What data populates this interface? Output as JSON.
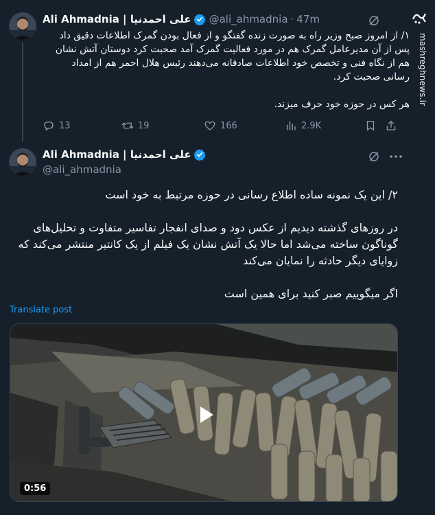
{
  "watermark": {
    "text": "mashreghnews.ir"
  },
  "tweet1": {
    "author_name": "Ali Ahmadnia | علی احمدنیا",
    "handle": "@ali_ahmadnia",
    "time": "47m",
    "lines": [
      "۱/ از امروز صبح وزیر راه به صورت زنده گفتگو و از فعال بودن گمرک اطلاعات دقیق داد",
      "پس از آن مدیرعامل گمرک هم در مورد فعالیت گمرک آمد صحبت کرد دوستان آتش نشان",
      "هم از نگاه فنی و تخصص خود اطلاعات صادقانه می‌دهند رئیس هلال احمر هم از امداد",
      "رسانی صحبت کرد."
    ],
    "line2": "هر کس در حوزه خود حرف میزند.",
    "actions": {
      "replies": "13",
      "reposts": "19",
      "likes": "166",
      "views": "2.9K"
    }
  },
  "tweet2": {
    "author_name": "Ali Ahmadnia | علی احمدنیا",
    "handle": "@ali_ahmadnia",
    "para1": "۲/ این یک نمونه ساده اطلاع رسانی در حوزه مرتبط به خود است",
    "para2_lines": [
      "در روزهای گذشته دیدیم از عکس دود و صدای انفجار تفاسیر متفاوت و تحلیل‌های",
      "گوناگون ساخته می‌شد اما حالا یک آتش نشان یک فیلم از یک کانتیر منتشر می‌کند که",
      "زوایای دیگر حادثه را نمایان می‌کند"
    ],
    "para3": "اگر میگوییم صبر کنید برای همین است",
    "translate_label": "Translate post",
    "video_duration": "0:56"
  },
  "colors": {
    "background": "#15202b",
    "accent": "#1d9bf0",
    "muted": "#8b98a5"
  }
}
